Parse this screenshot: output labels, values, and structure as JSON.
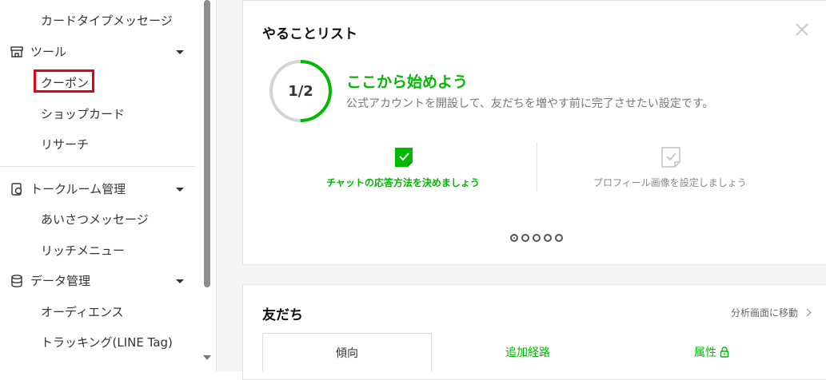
{
  "sidebar": {
    "card_type_message": "カードタイプメッセージ",
    "tools": {
      "label": "ツール",
      "icon": "shop-icon"
    },
    "coupon": "クーポン",
    "shop_card": "ショップカード",
    "research": "リサーチ",
    "talk_room": {
      "label": "トークルーム管理",
      "icon": "chat-settings-icon"
    },
    "greeting": "あいさつメッセージ",
    "rich_menu": "リッチメニュー",
    "data_mgmt": {
      "label": "データ管理",
      "icon": "database-icon"
    },
    "audience": "オーディエンス",
    "tracking": "トラッキング(LINE Tag)"
  },
  "todo": {
    "title": "やることリスト",
    "progress_label": "1/2",
    "progress_fraction": 0.5,
    "headline": "ここから始めよう",
    "description": "公式アカウントを開設して、友だちを増やす前に完了させたい設定です。",
    "tasks": [
      {
        "label": "チャットの応答方法を決めましょう",
        "done": true
      },
      {
        "label": "プロフィール画像を設定しましょう",
        "done": false
      }
    ],
    "page_indicator": {
      "count": 5,
      "active": 1
    }
  },
  "friends": {
    "title": "友だち",
    "analysis_link": "分析画面に移動",
    "tabs": [
      "傾向",
      "追加経路",
      "属性"
    ]
  },
  "colors": {
    "accent": "#00b900",
    "highlight_box": "#e60012",
    "ring_track": "#d4d4d4"
  }
}
